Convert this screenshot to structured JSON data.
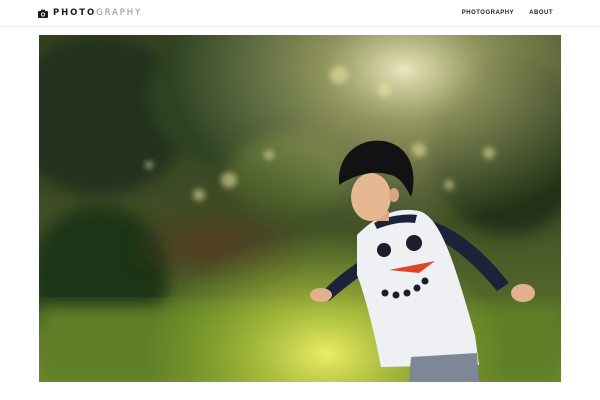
{
  "header": {
    "brand": {
      "icon": "camera-icon",
      "name_strong": "PHOTO",
      "name_light": "GRAPHY"
    },
    "nav": [
      {
        "label": "PHOTOGRAPHY"
      },
      {
        "label": "ABOUT"
      }
    ]
  },
  "main": {
    "photo": {
      "subject": "child in snowman shirt running outdoors in backlit garden"
    }
  },
  "colors": {
    "text": "#222222",
    "brand_light": "#8a8a8a",
    "divider": "#ececec"
  }
}
